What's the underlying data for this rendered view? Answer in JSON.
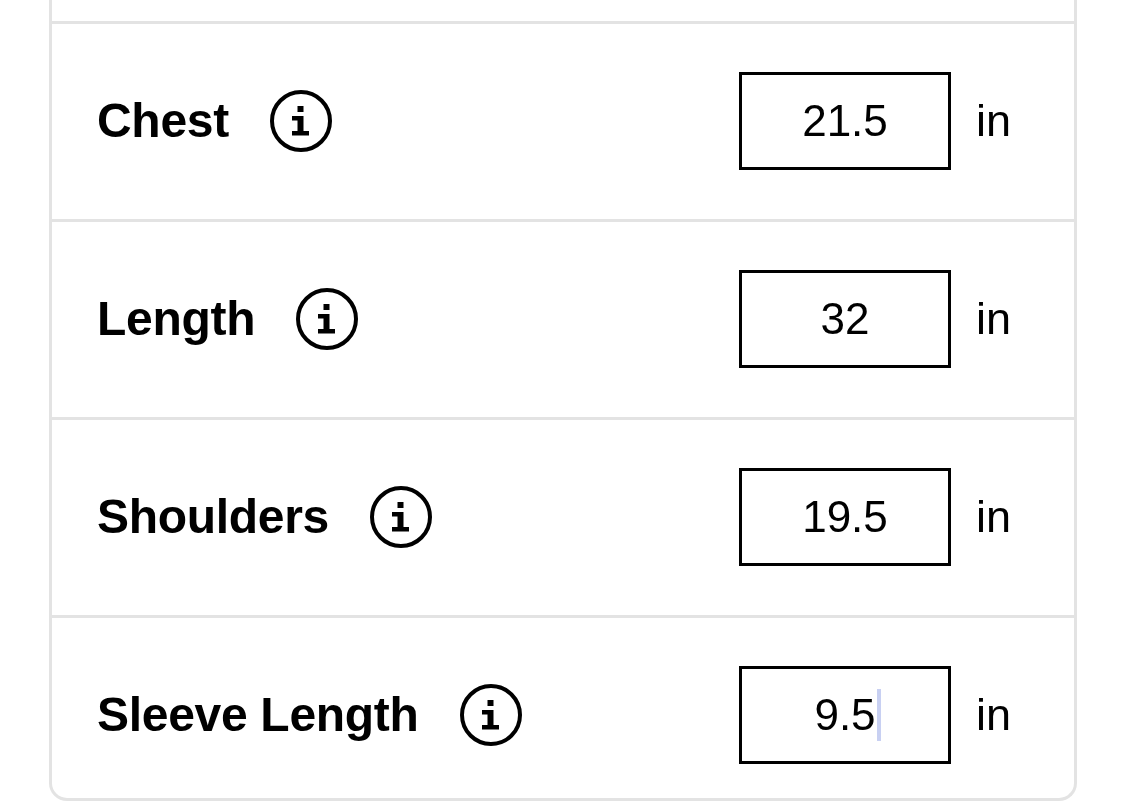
{
  "rows": [
    {
      "label": "Chest",
      "value": "21.5",
      "unit": "in",
      "focused": false
    },
    {
      "label": "Length",
      "value": "32",
      "unit": "in",
      "focused": false
    },
    {
      "label": "Shoulders",
      "value": "19.5",
      "unit": "in",
      "focused": false
    },
    {
      "label": "Sleeve Length",
      "value": "9.5",
      "unit": "in",
      "focused": true
    }
  ]
}
